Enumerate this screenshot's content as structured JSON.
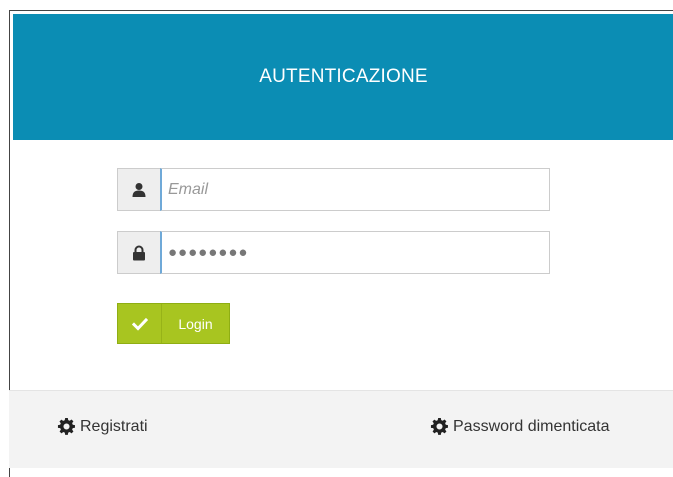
{
  "header": {
    "title": "AUTENTICAZIONE"
  },
  "form": {
    "email": {
      "placeholder": "Email",
      "value": "",
      "icon": "user-icon"
    },
    "password": {
      "masked_value": "●●●●●●●●",
      "icon": "lock-icon"
    },
    "login": {
      "label": "Login",
      "icon": "check-icon"
    }
  },
  "footer": {
    "register": {
      "label": "Registrati",
      "icon": "gear-icon"
    },
    "forgot": {
      "label": "Password dimenticata",
      "icon": "gear-icon"
    }
  },
  "colors": {
    "header_bg": "#0b8db4",
    "button_bg": "#a8c520",
    "footer_bg": "#f3f3f3"
  }
}
